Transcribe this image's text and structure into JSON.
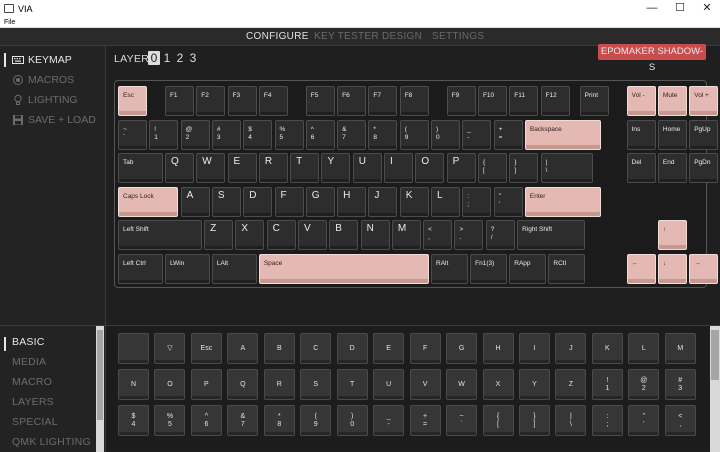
{
  "window": {
    "title": "VIA",
    "minimize": "—",
    "maximize": "☐",
    "close": "✕"
  },
  "menu": {
    "file": "File"
  },
  "nav": {
    "tabs": [
      {
        "label": "CONFIGURE",
        "active": true
      },
      {
        "label": "KEY TESTER",
        "active": false
      },
      {
        "label": "DESIGN",
        "active": false
      },
      {
        "label": "SETTINGS",
        "active": false
      }
    ]
  },
  "sidebar": {
    "items": [
      {
        "label": "KEYMAP",
        "icon": "keyboard-icon",
        "active": true
      },
      {
        "label": "MACROS",
        "icon": "record-icon",
        "active": false
      },
      {
        "label": "LIGHTING",
        "icon": "lightbulb-icon",
        "active": false
      },
      {
        "label": "SAVE + LOAD",
        "icon": "floppy-disk-icon",
        "active": false
      }
    ]
  },
  "layers": {
    "label": "LAYER",
    "items": [
      "0",
      "1",
      "2",
      "3"
    ],
    "active": "0"
  },
  "keyboard_name": "EPOMAKER SHADOW-S",
  "colors": {
    "accent_key": "#e5b9b3",
    "key": "#2d2d2d",
    "badge": "#c94d4d",
    "background": "#1f1f1f"
  },
  "keys": [
    {
      "l": "Esc",
      "a": true
    },
    {
      "l": "F1"
    },
    {
      "l": "F2"
    },
    {
      "l": "F3"
    },
    {
      "l": "F4"
    },
    {
      "l": "F5"
    },
    {
      "l": "F6"
    },
    {
      "l": "F7"
    },
    {
      "l": "F8"
    },
    {
      "l": "F9"
    },
    {
      "l": "F10"
    },
    {
      "l": "F11"
    },
    {
      "l": "F12"
    },
    {
      "l": "Print"
    },
    {
      "l": "Vol -",
      "a": true
    },
    {
      "l": "Mute",
      "a": true
    },
    {
      "l": "Vol +",
      "a": true
    },
    {
      "l": "~\n`"
    },
    {
      "l": "!\n1"
    },
    {
      "l": "@\n2"
    },
    {
      "l": "#\n3"
    },
    {
      "l": "$\n4"
    },
    {
      "l": "%\n5"
    },
    {
      "l": "^\n6"
    },
    {
      "l": "&\n7"
    },
    {
      "l": "*\n8"
    },
    {
      "l": "(\n9"
    },
    {
      "l": ")\n0"
    },
    {
      "l": "_\n-"
    },
    {
      "l": "+\n="
    },
    {
      "l": "Backspace",
      "a": true
    },
    {
      "l": "Ins"
    },
    {
      "l": "Home"
    },
    {
      "l": "PgUp"
    },
    {
      "l": "Tab"
    },
    {
      "l": "Q",
      "t": "L"
    },
    {
      "l": "W",
      "t": "L"
    },
    {
      "l": "E",
      "t": "L"
    },
    {
      "l": "R",
      "t": "L"
    },
    {
      "l": "T",
      "t": "L"
    },
    {
      "l": "Y",
      "t": "L"
    },
    {
      "l": "U",
      "t": "L"
    },
    {
      "l": "I",
      "t": "L"
    },
    {
      "l": "O",
      "t": "L"
    },
    {
      "l": "P",
      "t": "L"
    },
    {
      "l": "{\n["
    },
    {
      "l": "}\n]"
    },
    {
      "l": "|\n\\"
    },
    {
      "l": "Del"
    },
    {
      "l": "End"
    },
    {
      "l": "PgDn"
    },
    {
      "l": "Caps Lock",
      "a": true
    },
    {
      "l": "A",
      "t": "L"
    },
    {
      "l": "S",
      "t": "L"
    },
    {
      "l": "D",
      "t": "L"
    },
    {
      "l": "F",
      "t": "L"
    },
    {
      "l": "G",
      "t": "L"
    },
    {
      "l": "H",
      "t": "L"
    },
    {
      "l": "J",
      "t": "L"
    },
    {
      "l": "K",
      "t": "L"
    },
    {
      "l": "L",
      "t": "L"
    },
    {
      "l": ":\n;"
    },
    {
      "l": "\"\n'"
    },
    {
      "l": "Enter",
      "a": true
    },
    {
      "l": "Left Shift"
    },
    {
      "l": "Z",
      "t": "L"
    },
    {
      "l": "X",
      "t": "L"
    },
    {
      "l": "C",
      "t": "L"
    },
    {
      "l": "V",
      "t": "L"
    },
    {
      "l": "B",
      "t": "L"
    },
    {
      "l": "N",
      "t": "L"
    },
    {
      "l": "M",
      "t": "L"
    },
    {
      "l": "<\n,"
    },
    {
      "l": ">\n."
    },
    {
      "l": "?\n/"
    },
    {
      "l": "Right Shift"
    },
    {
      "l": "↑",
      "a": true
    },
    {
      "l": "Left Ctrl"
    },
    {
      "l": "LWin"
    },
    {
      "l": "LAlt"
    },
    {
      "l": "Space",
      "a": true
    },
    {
      "l": "RAlt"
    },
    {
      "l": "Fn1(3)"
    },
    {
      "l": "RApp"
    },
    {
      "l": "RCtl"
    },
    {
      "l": "←",
      "a": true
    },
    {
      "l": "↓",
      "a": true
    },
    {
      "l": "→",
      "a": true
    }
  ],
  "categories": {
    "items": [
      {
        "label": "BASIC",
        "active": true
      },
      {
        "label": "MEDIA",
        "active": false
      },
      {
        "label": "MACRO",
        "active": false
      },
      {
        "label": "LAYERS",
        "active": false
      },
      {
        "label": "SPECIAL",
        "active": false
      },
      {
        "label": "QMK LIGHTING",
        "active": false
      }
    ]
  },
  "keycodes": [
    "",
    "▽",
    "Esc",
    "A",
    "B",
    "C",
    "D",
    "E",
    "F",
    "G",
    "H",
    "I",
    "J",
    "K",
    "L",
    "M",
    "N",
    "O",
    "P",
    "Q",
    "R",
    "S",
    "T",
    "U",
    "V",
    "W",
    "X",
    "Y",
    "Z",
    "!\n1",
    "@\n2",
    "#\n3",
    "$\n4",
    "%\n5",
    "^\n6",
    "&\n7",
    "*\n8",
    "(\n9",
    ")\n0",
    "_\n-",
    "+\n=",
    "~\n`",
    "{\n[",
    "}\n]",
    "|\n\\",
    ":\n;",
    "\"\n'",
    "<\n,"
  ]
}
